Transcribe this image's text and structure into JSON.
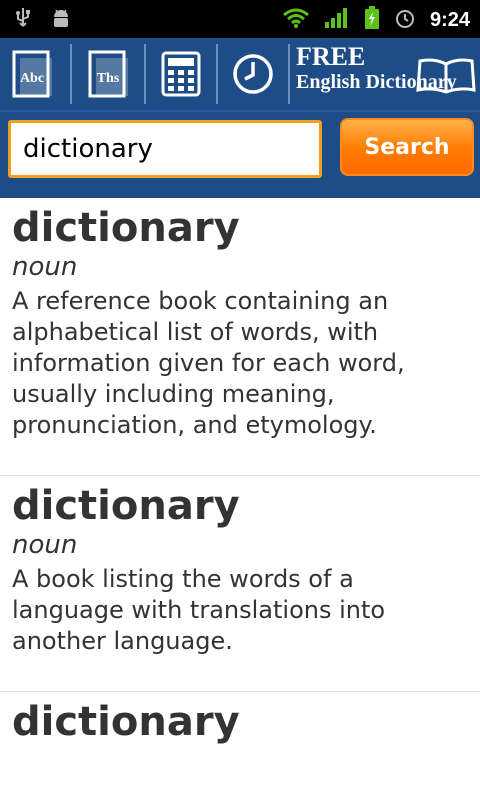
{
  "status_bar": {
    "time": "9:24",
    "icons": [
      "usb-icon",
      "android-debug-icon",
      "wifi-icon",
      "signal-icon",
      "battery-charging-icon",
      "alarm-icon"
    ]
  },
  "toolbar": {
    "buttons": [
      {
        "name": "abc-dictionary-button",
        "label": "Abc"
      },
      {
        "name": "thesaurus-button",
        "label": "Ths"
      },
      {
        "name": "calculator-button",
        "label": ""
      },
      {
        "name": "history-button",
        "label": ""
      }
    ],
    "brand_line1": "FREE",
    "brand_line2": "English Dictionary"
  },
  "search": {
    "value": "dictionary",
    "button_label": "Search"
  },
  "colors": {
    "toolbar_bg": "#1e4c86",
    "accent_orange": "#ff7a00",
    "input_border": "#f0a020",
    "text": "#333333"
  },
  "entries": [
    {
      "word": "dictionary",
      "pos": "noun",
      "definition": "A reference book containing an alphabetical list of words, with information given for each word, usually including meaning, pronunciation, and etymology."
    },
    {
      "word": "dictionary",
      "pos": "noun",
      "definition": "A book listing the words of a language with translations into another language."
    },
    {
      "word": "dictionary",
      "pos": "",
      "definition": ""
    }
  ]
}
